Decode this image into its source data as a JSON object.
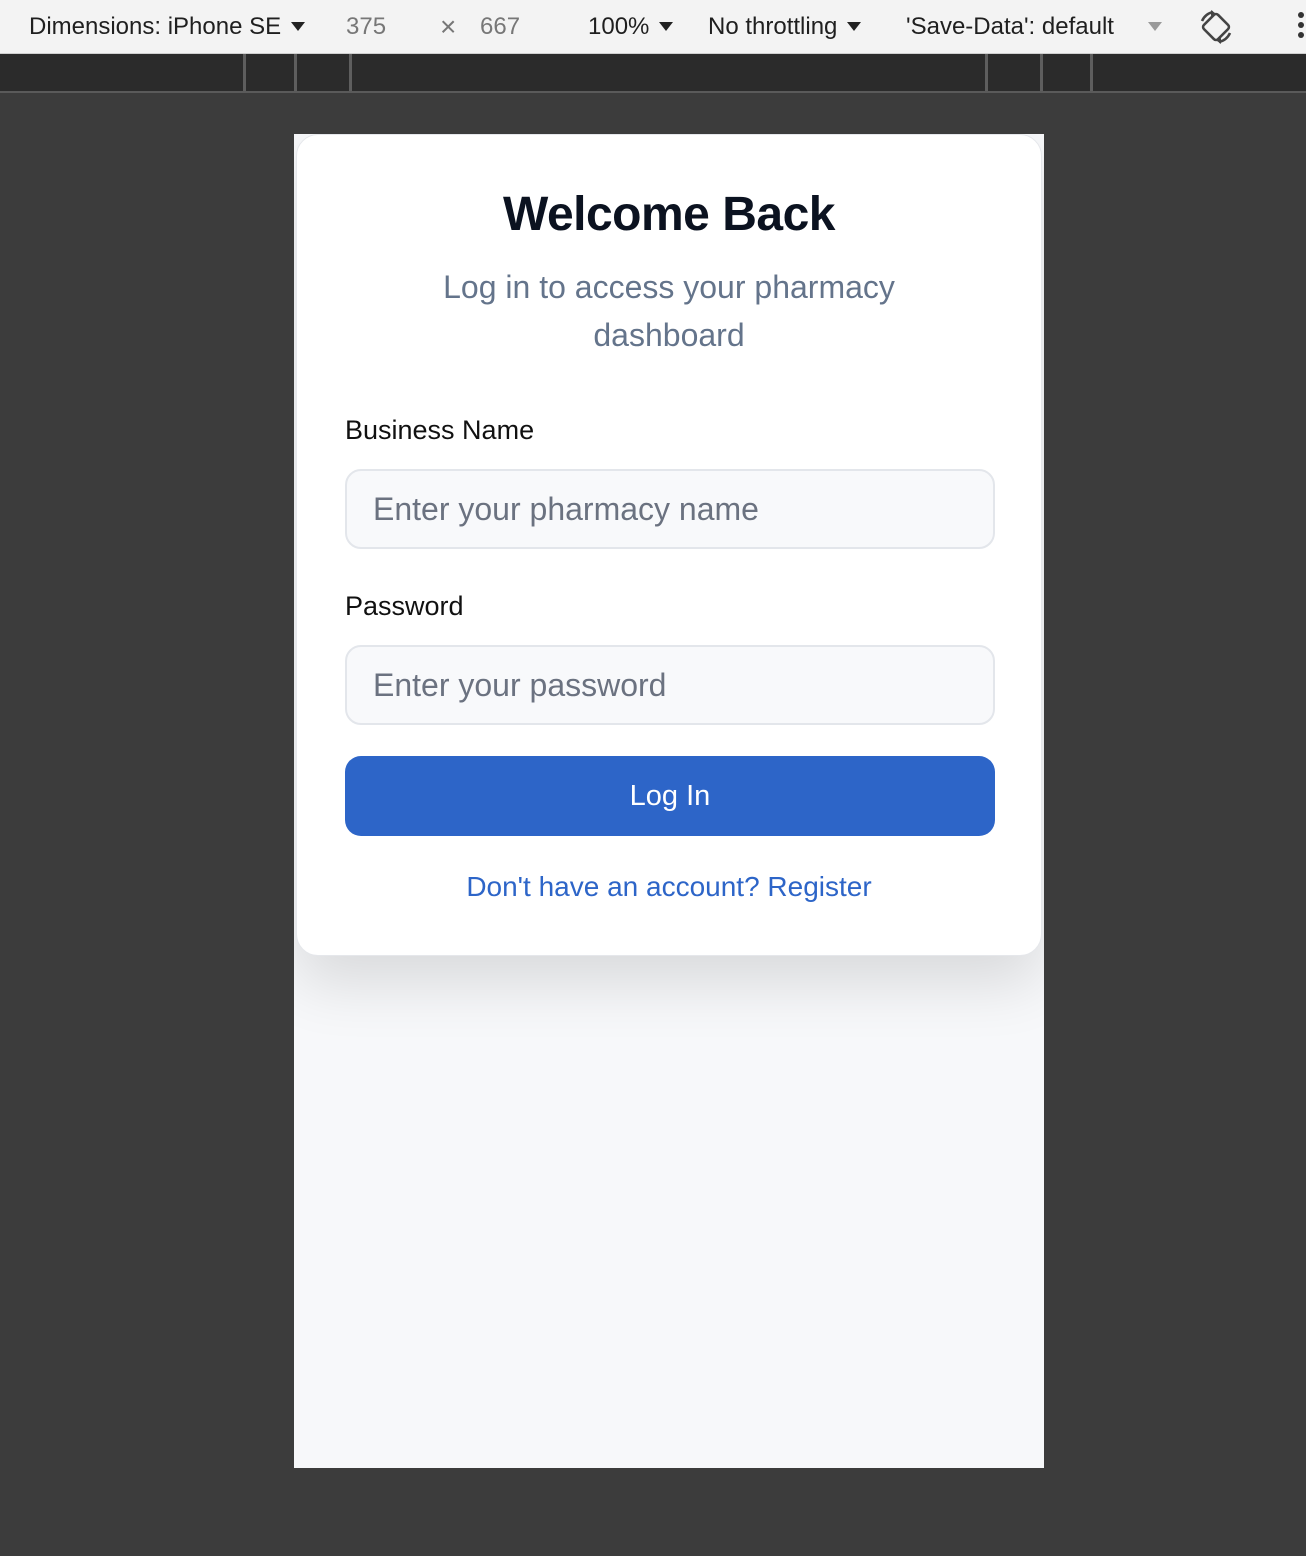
{
  "devtools": {
    "dimensions_label": "Dimensions: iPhone SE",
    "width_value": "375",
    "times_symbol": "×",
    "height_value": "667",
    "zoom_label": "100%",
    "throttling_label": "No throttling",
    "save_data_label": "'Save-Data': default",
    "icons": [
      "chevron-down-icon",
      "rotate-icon",
      "more-options-icon"
    ]
  },
  "login": {
    "title": "Welcome Back",
    "subtitle": "Log in to access your pharmacy dashboard",
    "business_name_label": "Business Name",
    "business_name_placeholder": "Enter your pharmacy name",
    "password_label": "Password",
    "password_placeholder": "Enter your password",
    "submit_label": "Log In",
    "register_link": "Don't have an account? Register"
  },
  "colors": {
    "primary": "#2d65c8",
    "title": "#0b1220",
    "muted_text": "#64748b",
    "page_background": "#f7f8fa",
    "devtools_background": "#3c3c3c"
  }
}
